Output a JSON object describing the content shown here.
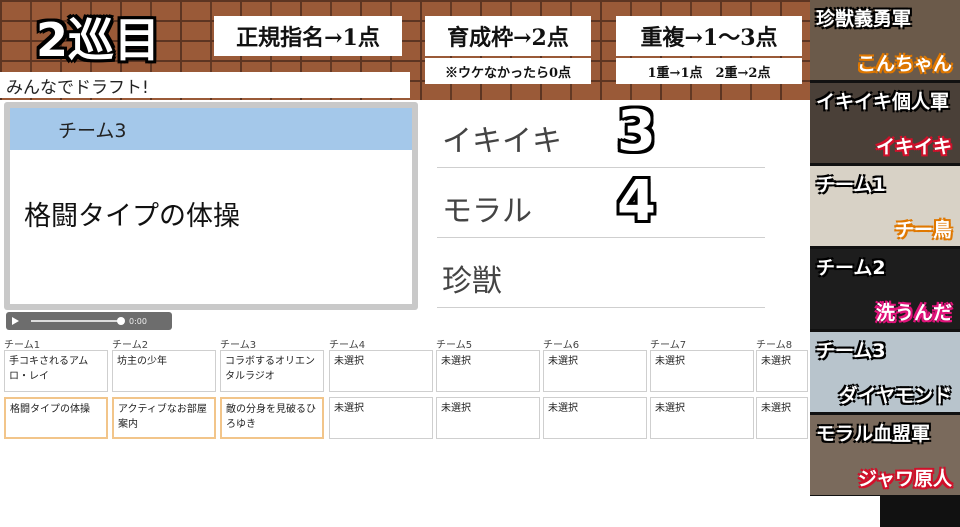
{
  "header": {
    "round": "2巡目",
    "rules": [
      {
        "main": "正規指名→1点",
        "sub": ""
      },
      {
        "main": "育成枠→2点",
        "sub": "※ウケなかったら0点"
      },
      {
        "main": "重複→1〜3点",
        "sub": "1重→1点　2重→2点"
      }
    ],
    "subtitle": "みんなでドラフト!"
  },
  "slide": {
    "team": "チーム3",
    "pick": "格闘タイプの体操"
  },
  "player": {
    "time": "0:00",
    "progress": 0.95
  },
  "scores": [
    {
      "label": "イキイキ",
      "value": "3"
    },
    {
      "label": "モラル",
      "value": "4"
    },
    {
      "label": "珍獣",
      "value": ""
    }
  ],
  "grid": {
    "teams": [
      "チーム1",
      "チーム2",
      "チーム3",
      "チーム4",
      "チーム5",
      "チーム6",
      "チーム7",
      "チーム8"
    ],
    "rows": [
      [
        "手コキされるアムロ・レイ",
        "坊主の少年",
        "コラボするオリエンタルラジオ",
        "未選択",
        "未選択",
        "未選択",
        "未選択",
        "未選択"
      ],
      [
        "格闘タイプの体操",
        "アクティブなお部屋案内",
        "敵の分身を見破るひろゆき",
        "未選択",
        "未選択",
        "未選択",
        "未選択",
        "未選択"
      ]
    ]
  },
  "sidebar": [
    {
      "title": "珍獣義勇軍",
      "name": "こんちゃん",
      "style": "orange",
      "bg": "#6b5a4a"
    },
    {
      "title": "イキイキ個人軍",
      "name": "イキイキ",
      "style": "red",
      "bg": "#4a4038"
    },
    {
      "title": "チーム1",
      "name": "チー鳥",
      "style": "orange",
      "bg": "#d8d2c6"
    },
    {
      "title": "チーム2",
      "name": "洗うんだ",
      "style": "pink",
      "bg": "#1d1d1d"
    },
    {
      "title": "チーム3",
      "name": "ダイヤモンド",
      "style": "dark",
      "bg": "#b8c4cc"
    },
    {
      "title": "モラル血盟軍",
      "name": "ジャワ原人",
      "style": "red",
      "bg": "#7a6a5c"
    }
  ]
}
